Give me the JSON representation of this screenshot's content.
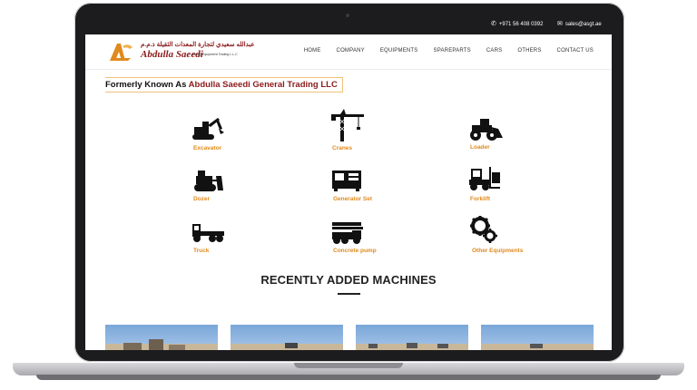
{
  "topbar": {
    "phone": "+971 56 408 0392",
    "email": "sales@asgt.ae"
  },
  "logo": {
    "arabic": "عبدالله سعيدي لتجارة المعدات الثقيلة ذ.م.م",
    "name": "Abdulla Saeedi",
    "subtitle": "Heavy Equipment Trading L.L.C"
  },
  "nav": [
    "HOME",
    "COMPANY",
    "EQUIPMENTS",
    "SPAREPARTS",
    "CARS",
    "OTHERS",
    "CONTACT US"
  ],
  "formerly": {
    "prefix": "Formerly Known As ",
    "name": "Abdulla Saeedi General Trading LLC"
  },
  "categories": [
    {
      "label": "Excavator",
      "icon": "excavator-icon"
    },
    {
      "label": "Cranes",
      "icon": "crane-icon"
    },
    {
      "label": "Loader",
      "icon": "loader-icon"
    },
    {
      "label": "Dozer",
      "icon": "dozer-icon"
    },
    {
      "label": "Generator Set",
      "icon": "generator-icon"
    },
    {
      "label": "Forklift",
      "icon": "forklift-icon"
    },
    {
      "label": "Truck",
      "icon": "truck-icon"
    },
    {
      "label": "Concrete pump",
      "icon": "concrete-pump-icon"
    },
    {
      "label": "Other Equipments",
      "icon": "gears-icon"
    }
  ],
  "recent": {
    "title": "RECENTLY ADDED MACHINES"
  },
  "colors": {
    "brand_red": "#8b1a1a",
    "accent_orange": "#e08a1e",
    "frame": "#1c1c1e"
  }
}
